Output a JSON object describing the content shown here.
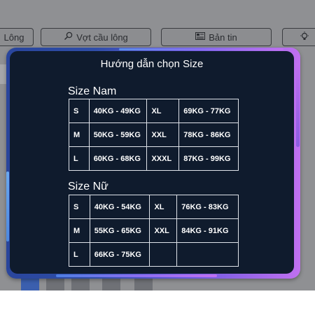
{
  "nav": {
    "items": [
      {
        "label": "Lông",
        "icon": ""
      },
      {
        "label": "Vợt cầu lông",
        "icon": "search-icon"
      },
      {
        "label": "Bản tin",
        "icon": "newspaper-icon"
      },
      {
        "label": "",
        "icon": "lightbulb-icon"
      }
    ]
  },
  "modal": {
    "title": "Hướng dẫn chọn Size",
    "sections": [
      {
        "title": "Size Nam",
        "rows": [
          [
            "S",
            "40KG - 49KG",
            "XL",
            "69KG - 77KG"
          ],
          [
            "M",
            "50KG - 59KG",
            "XXL",
            "78KG - 86KG"
          ],
          [
            "L",
            "60KG - 68KG",
            "XXXL",
            "87KG - 99KG"
          ]
        ]
      },
      {
        "title": "Size Nữ",
        "rows": [
          [
            "S",
            "40KG - 54KG",
            "XL",
            "76KG - 83KG"
          ],
          [
            "M",
            "55KG - 65KG",
            "XXL",
            "84KG - 91KG"
          ],
          [
            "L",
            "66KG - 75KG",
            "",
            ""
          ]
        ]
      }
    ]
  },
  "colors": {
    "modal_background": "#0f1b2d",
    "border_gradient_start": "#29459c",
    "border_gradient_end": "#c070f0",
    "overlay": "#8f9093"
  }
}
